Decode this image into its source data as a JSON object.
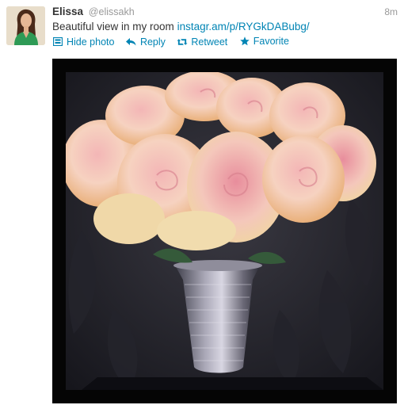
{
  "tweet": {
    "author_name": "Elissa",
    "author_handle": "@elissakh",
    "time": "8m",
    "text": "Beautiful view in my room",
    "link": "instagr.am/p/RYGkDABubg/",
    "actions": {
      "hide_photo": "Hide photo",
      "reply": "Reply",
      "retweet": "Retweet",
      "favorite": "Favorite"
    }
  },
  "colors": {
    "link": "#0084b4",
    "name": "#333333",
    "meta": "#999999"
  },
  "icons": {
    "hide_photo": "photo-icon",
    "reply": "reply-arrow-icon",
    "retweet": "retweet-icon",
    "favorite": "star-icon"
  }
}
